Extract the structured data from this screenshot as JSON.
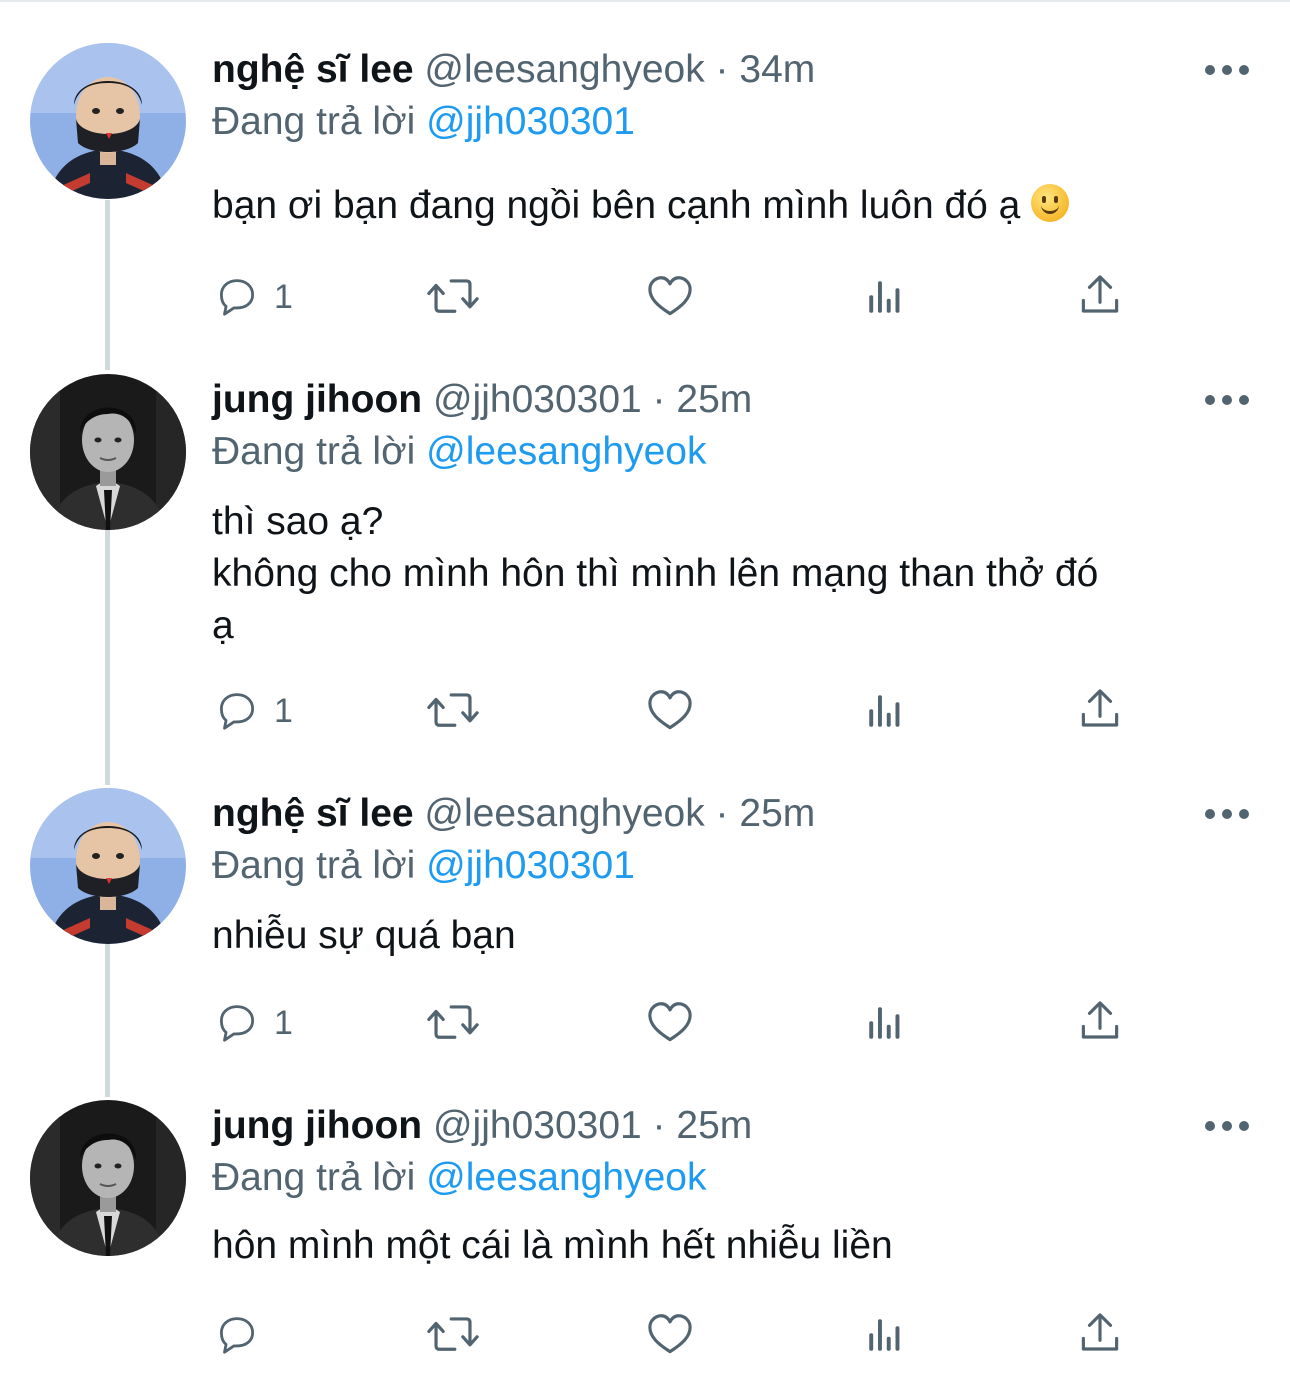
{
  "tweets": [
    {
      "name": "nghệ sĩ lee",
      "handle": "@leesanghyeok",
      "sep": "·",
      "time": "34m",
      "replying_label": "Đang trả lời",
      "replying_to": "@jjh030301",
      "text": "bạn ơi bạn đang ngồi bên cạnh mình luôn đó ạ",
      "emoji": "slightly-smiling-face",
      "reply_count": "1",
      "avatar": "masked-player-avatar"
    },
    {
      "name": "jung jihoon",
      "handle": "@jjh030301",
      "sep": "·",
      "time": "25m",
      "replying_label": "Đang trả lời",
      "replying_to": "@leesanghyeok",
      "text": "thì sao ạ?\nkhông cho mình hôn thì mình lên mạng than thở đó\nạ",
      "reply_count": "1",
      "avatar": "suit-man-avatar"
    },
    {
      "name": "nghệ sĩ lee",
      "handle": "@leesanghyeok",
      "sep": "·",
      "time": "25m",
      "replying_label": "Đang trả lời",
      "replying_to": "@jjh030301",
      "text": "nhiễu sự quá bạn",
      "reply_count": "1",
      "avatar": "masked-player-avatar"
    },
    {
      "name": "jung jihoon",
      "handle": "@jjh030301",
      "sep": "·",
      "time": "25m",
      "replying_label": "Đang trả lời",
      "replying_to": "@leesanghyeok",
      "text": "hôn mình một cái là mình hết nhiễu liền",
      "reply_count": "",
      "avatar": "suit-man-avatar"
    }
  ],
  "colors": {
    "text": "#0f1419",
    "secondary": "#536471",
    "link": "#1d9bf0",
    "thread_line": "#cfd9de"
  },
  "icons": [
    "reply-icon",
    "retweet-icon",
    "like-icon",
    "analytics-icon",
    "share-icon",
    "more-icon"
  ]
}
